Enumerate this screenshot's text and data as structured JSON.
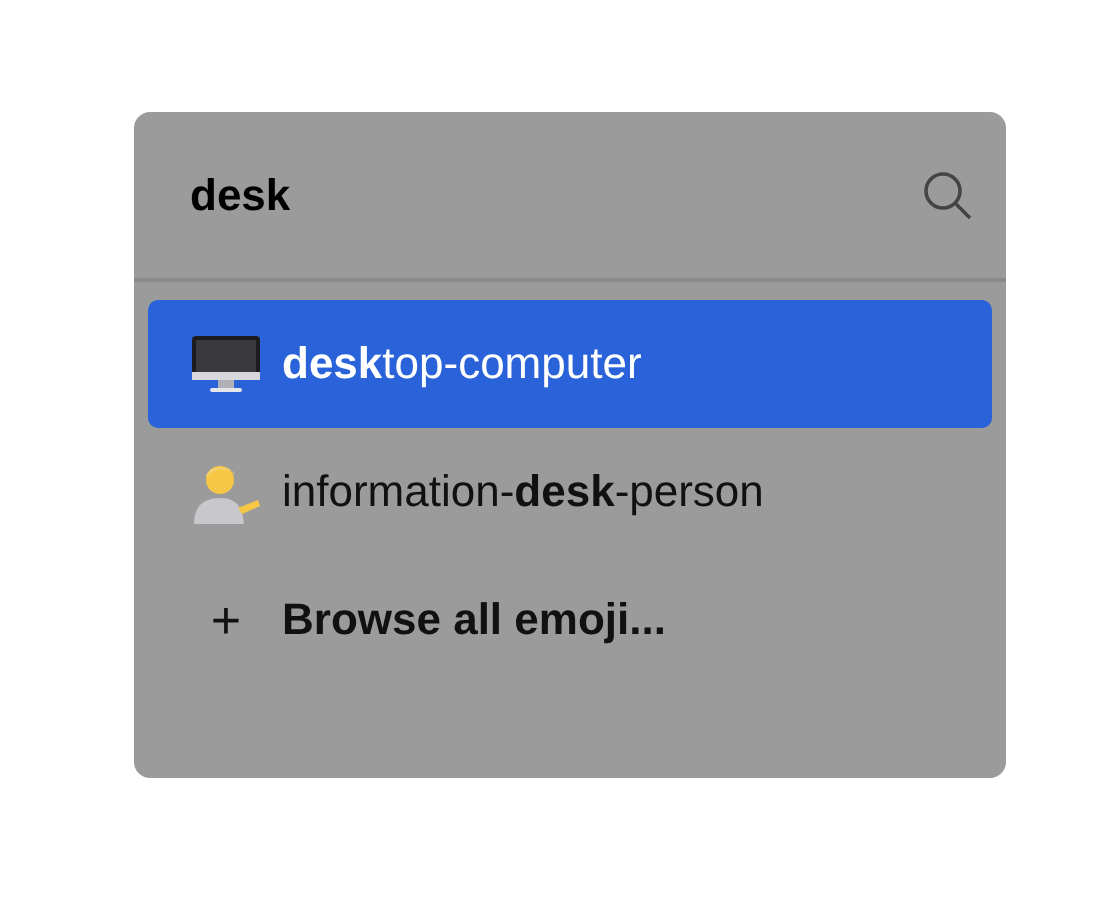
{
  "search": {
    "value": "desk"
  },
  "results": [
    {
      "kind": "emoji",
      "label": "**desk**top-computer",
      "selected": true
    },
    {
      "kind": "emoji",
      "label": "information-**desk**-person",
      "selected": false
    },
    {
      "kind": "action",
      "symbol": "+",
      "label": "Browse all emoji...",
      "selected": false
    }
  ]
}
